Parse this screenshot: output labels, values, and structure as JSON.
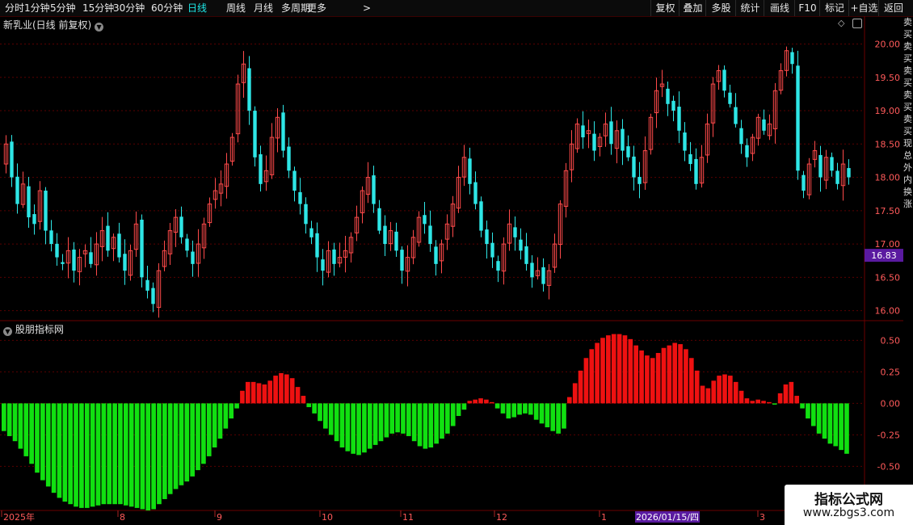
{
  "toolbar": {
    "periods": [
      "分时",
      "1分钟",
      "5分钟",
      "15分钟",
      "30分钟",
      "60分钟",
      "日线",
      "周线",
      "月线",
      "多周期",
      "更多"
    ],
    "active_period": "日线",
    "more_arrow": ">",
    "right_buttons": [
      "复权",
      "叠加",
      "多股",
      "统计",
      "画线",
      "F10",
      "标记",
      "+自选",
      "返回"
    ]
  },
  "main_panel": {
    "title": "新乳业(日线 前复权)",
    "price_tag": "16.83",
    "price_axis_labels": [
      "20.00",
      "19.50",
      "19.00",
      "18.50",
      "18.00",
      "17.50",
      "17.00",
      "16.50",
      "16.00"
    ]
  },
  "indicator_panel": {
    "title": "股朋指标网",
    "axis_labels": [
      "0.50",
      "0.25",
      "0.00",
      "-0.25",
      "-0.50"
    ]
  },
  "date_axis": {
    "labels": [
      "2025年",
      "8",
      "9",
      "10",
      "11",
      "12",
      "1",
      "3"
    ],
    "highlight": "2026/01/15/四"
  },
  "watermark": {
    "title": "指标公式网",
    "url": "www.zbgs3.com"
  },
  "side_strip": "卖买卖买卖买卖买卖买现总外内换涨",
  "colors": {
    "up": "#ff4a4a",
    "down": "#2ee6e6",
    "hist_up": "#ee1111",
    "hist_down": "#11e011",
    "active": "#1ee8e8",
    "price_tag_bg": "#5a1aa0",
    "grid": "#5a0000"
  },
  "chart_data": [
    {
      "type": "candlestick",
      "y_range": [
        15.85,
        20.2
      ],
      "close_series": [
        18.5,
        18.0,
        17.6,
        17.9,
        17.4,
        17.3,
        17.8,
        17.2,
        17.0,
        16.8,
        16.7,
        16.9,
        16.6,
        16.8,
        16.9,
        16.7,
        17.0,
        17.2,
        16.9,
        17.1,
        16.8,
        16.6,
        16.9,
        17.3,
        16.5,
        16.3,
        16.1,
        16.6,
        16.9,
        17.2,
        17.4,
        17.1,
        16.9,
        16.7,
        17.0,
        17.3,
        17.6,
        17.8,
        17.9,
        18.2,
        18.6,
        19.4,
        19.7,
        19.0,
        18.3,
        17.9,
        18.1,
        18.6,
        18.9,
        18.4,
        18.1,
        17.8,
        17.6,
        17.3,
        17.1,
        16.8,
        16.6,
        16.9,
        16.7,
        16.8,
        16.9,
        17.1,
        17.4,
        17.8,
        18.0,
        17.6,
        17.2,
        17.0,
        17.2,
        16.9,
        16.6,
        16.8,
        17.1,
        17.4,
        17.3,
        17.0,
        16.7,
        17.0,
        17.3,
        17.6,
        18.0,
        18.3,
        17.9,
        17.6,
        17.2,
        17.0,
        16.8,
        16.6,
        17.0,
        17.3,
        17.1,
        16.9,
        16.7,
        16.5,
        16.6,
        16.4,
        16.6,
        17.0,
        17.6,
        18.1,
        18.5,
        18.8,
        18.6,
        18.7,
        18.4,
        18.6,
        18.8,
        18.5,
        18.7,
        18.4,
        18.3,
        18.0,
        17.9,
        18.4,
        18.9,
        19.3,
        19.4,
        19.1,
        19.0,
        18.7,
        18.4,
        18.2,
        17.9,
        18.3,
        18.8,
        19.4,
        19.6,
        19.3,
        19.1,
        18.8,
        18.5,
        18.3,
        18.6,
        18.9,
        18.7,
        18.8,
        19.3,
        19.6,
        19.9,
        19.7,
        18.1,
        17.8,
        18.2,
        18.4,
        18.0,
        18.3,
        18.1,
        17.9,
        18.2,
        18.0
      ],
      "ohlc_shown_only": true
    },
    {
      "type": "bar",
      "y_range": [
        -0.85,
        0.65
      ],
      "values": [
        -0.22,
        -0.26,
        -0.3,
        -0.36,
        -0.42,
        -0.48,
        -0.55,
        -0.61,
        -0.66,
        -0.71,
        -0.75,
        -0.78,
        -0.8,
        -0.82,
        -0.83,
        -0.83,
        -0.82,
        -0.81,
        -0.8,
        -0.8,
        -0.8,
        -0.8,
        -0.81,
        -0.82,
        -0.83,
        -0.84,
        -0.85,
        -0.84,
        -0.8,
        -0.76,
        -0.72,
        -0.68,
        -0.65,
        -0.62,
        -0.58,
        -0.53,
        -0.48,
        -0.42,
        -0.35,
        -0.28,
        -0.2,
        -0.12,
        -0.04,
        0.1,
        0.17,
        0.17,
        0.16,
        0.15,
        0.18,
        0.22,
        0.24,
        0.23,
        0.2,
        0.13,
        0.06,
        -0.03,
        -0.08,
        -0.14,
        -0.2,
        -0.25,
        -0.3,
        -0.35,
        -0.38,
        -0.4,
        -0.41,
        -0.39,
        -0.36,
        -0.33,
        -0.3,
        -0.27,
        -0.24,
        -0.23,
        -0.24,
        -0.26,
        -0.3,
        -0.34,
        -0.36,
        -0.35,
        -0.32,
        -0.28,
        -0.24,
        -0.18,
        -0.1,
        -0.05,
        0.02,
        0.03,
        0.04,
        0.03,
        0.01,
        -0.04,
        -0.08,
        -0.12,
        -0.11,
        -0.09,
        -0.08,
        -0.09,
        -0.13,
        -0.16,
        -0.19,
        -0.22,
        -0.24,
        -0.2,
        0.05,
        0.16,
        0.26,
        0.36,
        0.43,
        0.48,
        0.52,
        0.54,
        0.55,
        0.55,
        0.54,
        0.51,
        0.46,
        0.42,
        0.38,
        0.36,
        0.4,
        0.44,
        0.46,
        0.48,
        0.47,
        0.43,
        0.36,
        0.26,
        0.14,
        0.12,
        0.18,
        0.22,
        0.23,
        0.22,
        0.17,
        0.1,
        0.04,
        0.02,
        0.03,
        0.02,
        0.01,
        -0.01,
        0.08,
        0.15,
        0.17,
        0.06,
        -0.04,
        -0.12,
        -0.18,
        -0.24,
        -0.28,
        -0.32,
        -0.34,
        -0.37,
        -0.4
      ]
    }
  ]
}
